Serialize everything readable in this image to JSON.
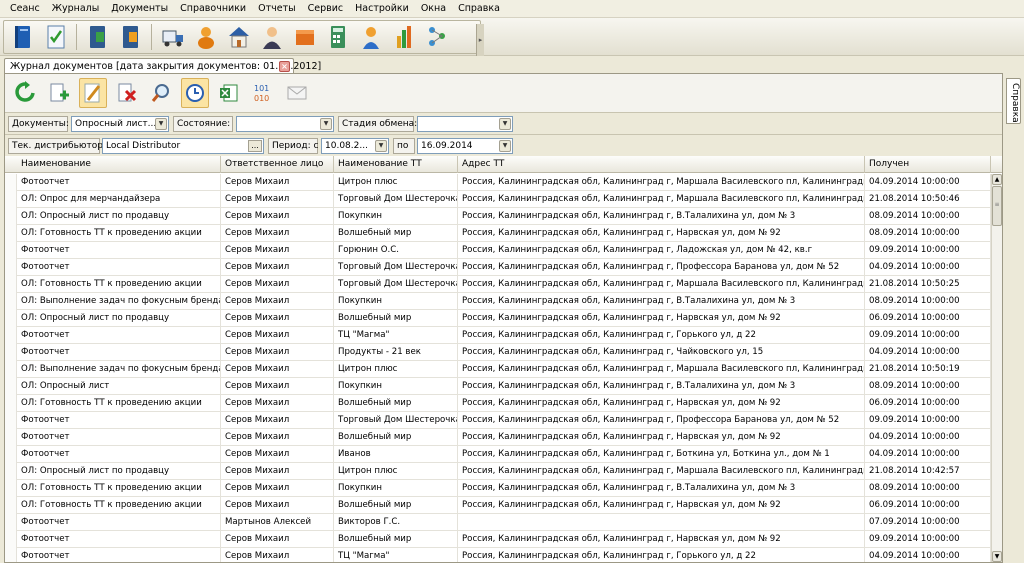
{
  "menu": [
    "Сеанс",
    "Журналы",
    "Документы",
    "Справочники",
    "Отчеты",
    "Сервис",
    "Настройки",
    "Окна",
    "Справка"
  ],
  "main_toolbar": {
    "icons": [
      "book-blue-icon",
      "checklist-icon",
      "book-green-icon",
      "book-orange-icon",
      "truck-icon",
      "people-icon",
      "house-icon",
      "person-icon",
      "box-icon",
      "calculator-icon",
      "person-blue-icon",
      "chart-bars-icon",
      "network-icon"
    ]
  },
  "tab": {
    "title": "Журнал документов [дата закрытия документов: 01.11.2012]",
    "close": "×"
  },
  "side_tab": {
    "label": "Справка"
  },
  "sub_toolbar": {
    "icons": [
      "refresh-icon",
      "add-document-icon",
      "edit-icon",
      "delete-icon",
      "find-icon",
      "clock-icon",
      "excel-icon",
      "numbers-icon",
      "envelope-icon"
    ]
  },
  "filters": {
    "documents_label": "Документы:",
    "documents_value": "Опросный лист...",
    "state_label": "Состояние:",
    "state_value": "",
    "exchange_label": "Стадия обмена:",
    "exchange_value": "",
    "distributor_label": "Тек. дистрибьютор:",
    "distributor_value": "Local Distributor",
    "dots": "...",
    "period_label": "Период: с",
    "period_from": "10.08.2...",
    "period_to_label": "по",
    "period_to": "16.09.2014"
  },
  "grid": {
    "columns": [
      "Наименование",
      "Ответственное лицо",
      "Наименование ТТ",
      "Адрес ТТ",
      "Получен"
    ],
    "rows": [
      [
        "Фотоотчет",
        "Серов Михаил",
        "Цитрон плюс",
        "Россия, Калининградская обл, Калининград г, Маршала Василевского пл, Калининградпл, д...",
        "04.09.2014 10:00:00"
      ],
      [
        "ОЛ: Опрос для мерчандайзера",
        "Серов Михаил",
        "Торговый Дом Шестерочка",
        "Россия, Калининградская обл, Калининград г, Маршала Василевского пл, Калининградпл, д...",
        "21.08.2014 10:50:46"
      ],
      [
        "ОЛ: Опросный лист по продавцу",
        "Серов Михаил",
        "Покупкин",
        "Россия, Калининградская обл, Калининград г, В.Талалихина ул, дом № 3",
        "08.09.2014 10:00:00"
      ],
      [
        "ОЛ: Готовность ТТ к проведению акции",
        "Серов Михаил",
        "Волшебный мир",
        "Россия, Калининградская обл, Калининград г, Нарвская ул, дом № 92",
        "08.09.2014 10:00:00"
      ],
      [
        "Фотоотчет",
        "Серов Михаил",
        "Горюнин О.С.",
        "Россия, Калининградская обл, Калининград г, Ладожская ул, дом № 42, кв.г",
        "09.09.2014 10:00:00"
      ],
      [
        "Фотоотчет",
        "Серов Михаил",
        "Торговый Дом Шестерочка",
        "Россия, Калининградская обл, Калининград г, Профессора Баранова ул, дом № 52",
        "04.09.2014 10:00:00"
      ],
      [
        "ОЛ: Готовность ТТ к проведению акции",
        "Серов Михаил",
        "Торговый Дом Шестерочка",
        "Россия, Калининградская обл, Калининград г, Маршала Василевского пл, Калининградпл, д...",
        "21.08.2014 10:50:25"
      ],
      [
        "ОЛ: Выполнение задач по фокусным брендам",
        "Серов Михаил",
        "Покупкин",
        "Россия, Калининградская обл, Калининград г, В.Талалихина ул, дом № 3",
        "08.09.2014 10:00:00"
      ],
      [
        "ОЛ: Опросный лист по продавцу",
        "Серов Михаил",
        "Волшебный мир",
        "Россия, Калининградская обл, Калининград г, Нарвская ул, дом № 92",
        "06.09.2014 10:00:00"
      ],
      [
        "Фотоотчет",
        "Серов Михаил",
        "ТЦ \"Магма\"",
        "Россия, Калининградская обл, Калининград г, Горького ул, д 22",
        "09.09.2014 10:00:00"
      ],
      [
        "Фотоотчет",
        "Серов Михаил",
        "Продукты - 21 век",
        "Россия, Калининградская обл, Калининград г, Чайковского ул, 15",
        "04.09.2014 10:00:00"
      ],
      [
        "ОЛ: Выполнение задач по фокусным брендам",
        "Серов Михаил",
        "Цитрон плюс",
        "Россия, Калининградская обл, Калининград г, Маршала Василевского пл, Калининградпл, д...",
        "21.08.2014 10:50:19"
      ],
      [
        "ОЛ: Опросный лист",
        "Серов Михаил",
        "Покупкин",
        "Россия, Калининградская обл, Калининград г, В.Талалихина ул, дом № 3",
        "08.09.2014 10:00:00"
      ],
      [
        "ОЛ: Готовность ТТ к проведению акции",
        "Серов Михаил",
        "Волшебный мир",
        "Россия, Калининградская обл, Калининград г, Нарвская ул, дом № 92",
        "06.09.2014 10:00:00"
      ],
      [
        "Фотоотчет",
        "Серов Михаил",
        "Торговый Дом Шестерочка",
        "Россия, Калининградская обл, Калининград г, Профессора Баранова ул, дом № 52",
        "09.09.2014 10:00:00"
      ],
      [
        "Фотоотчет",
        "Серов Михаил",
        "Волшебный мир",
        "Россия, Калининградская обл, Калининград г, Нарвская ул, дом № 92",
        "04.09.2014 10:00:00"
      ],
      [
        "Фотоотчет",
        "Серов Михаил",
        "Иванов",
        "Россия, Калининградская обл, Калининград г, Боткина ул, Боткина ул., дом № 1",
        "04.09.2014 10:00:00"
      ],
      [
        "ОЛ: Опросный лист по продавцу",
        "Серов Михаил",
        "Цитрон плюс",
        "Россия, Калининградская обл, Калининград г, Маршала Василевского пл, Калининградпл, д...",
        "21.08.2014 10:42:57"
      ],
      [
        "ОЛ: Готовность ТТ к проведению акции",
        "Серов Михаил",
        "Покупкин",
        "Россия, Калининградская обл, Калининград г, В.Талалихина ул, дом № 3",
        "08.09.2014 10:00:00"
      ],
      [
        "ОЛ: Готовность ТТ к проведению акции",
        "Серов Михаил",
        "Волшебный мир",
        "Россия, Калининградская обл, Калининград г, Нарвская ул, дом № 92",
        "06.09.2014 10:00:00"
      ],
      [
        "Фотоотчет",
        "Мартынов Алексей",
        "Викторов Г.С.",
        "",
        "07.09.2014 10:00:00"
      ],
      [
        "Фотоотчет",
        "Серов Михаил",
        "Волшебный мир",
        "Россия, Калининградская обл, Калининград г, Нарвская ул, дом № 92",
        "09.09.2014 10:00:00"
      ],
      [
        "Фотоотчет",
        "Серов Михаил",
        "ТЦ \"Магма\"",
        "Россия, Калининградская обл, Калининград г, Горького ул, д 22",
        "04.09.2014 10:00:00"
      ]
    ]
  },
  "colors": {
    "window_bg": "#ece9d8",
    "grid_bg": "#ffffff",
    "selected_button": "#fbe4a4"
  }
}
